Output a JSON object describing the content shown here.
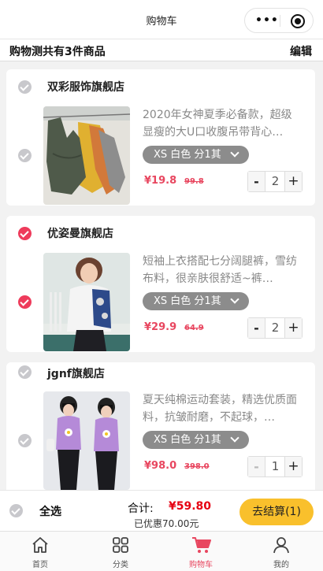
{
  "nav": {
    "title": "购物车"
  },
  "summary": {
    "text": "购物测共有3件商品",
    "edit_label": "编辑"
  },
  "shops": [
    {
      "name": "双彩服饰旗舰店",
      "checked": false,
      "item": {
        "title": "2020年女神夏季必备款，超级显瘦的大U口收腹吊带背心…",
        "spec": "XS 白色 分1其",
        "price": "¥19.8",
        "old_price": "99.8",
        "qty": "2",
        "minus": "-",
        "plus": "+"
      }
    },
    {
      "name": "优姿曼旗舰店",
      "checked": true,
      "item": {
        "title": "短袖上衣搭配七分阔腿裤，雪纺布料，很亲肤很舒适~裤…",
        "spec": "XS 白色 分1其",
        "price": "¥29.9",
        "old_price": "64.9",
        "qty": "2",
        "minus": "-",
        "plus": "+"
      }
    },
    {
      "name": "jgnf旗舰店",
      "checked": false,
      "item": {
        "title": "夏天纯棉运动套装，精选优质面料，抗皱耐磨，不起球，…",
        "spec": "XS 白色 分1其",
        "price": "¥98.0",
        "old_price": "398.0",
        "qty": "1",
        "minus": "-",
        "plus": "+"
      }
    }
  ],
  "bottom": {
    "select_all": "全选",
    "total_label": "合计:",
    "total_value": "¥59.80",
    "discount": "已优惠70.00元",
    "checkout": "去结算(1)"
  },
  "tabbar": {
    "items": [
      {
        "label": "首页",
        "icon": "home-icon"
      },
      {
        "label": "分类",
        "icon": "grid-icon"
      },
      {
        "label": "购物车",
        "icon": "cart-icon",
        "active": true
      },
      {
        "label": "我的",
        "icon": "user-icon"
      }
    ]
  },
  "colors": {
    "accent": "#e8465f",
    "checkout": "#f9c02c",
    "price_total": "#e60012"
  }
}
